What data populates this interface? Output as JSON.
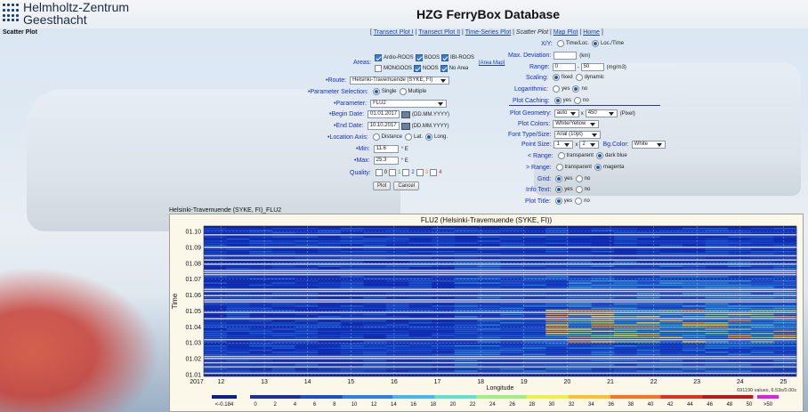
{
  "header": {
    "logo_line1": "Helmholtz-Zentrum",
    "logo_line2": "Geesthacht",
    "title": "HZG FerryBox Database",
    "section": "Scatter Plot"
  },
  "nav": {
    "open": "[",
    "items": [
      {
        "label": "Transect Plot I",
        "current": false
      },
      {
        "label": "Transect Plot II",
        "current": false
      },
      {
        "label": "Time-Series Plot",
        "current": false
      },
      {
        "label": "Scatter Plot",
        "current": true
      },
      {
        "label": "Map Plot",
        "current": false
      },
      {
        "label": "Home",
        "current": false
      }
    ],
    "sep": "|",
    "close": "]"
  },
  "form": {
    "areas_label": "Areas:",
    "areas": [
      {
        "label": "Ardio-ROOS",
        "checked": true
      },
      {
        "label": "BOOS",
        "checked": true
      },
      {
        "label": "IBI-ROOS",
        "checked": true
      },
      {
        "label": "MONGOOS",
        "checked": false
      },
      {
        "label": "NOOS",
        "checked": true
      },
      {
        "label": "No Area",
        "checked": true
      }
    ],
    "area_map_link": "[Area Map]",
    "route_label": "Route:",
    "route_value": "Helsinki-Travemuende (SYKE, FI)",
    "param_sel_label": "Parameter Selection:",
    "param_sel_single": "Single",
    "param_sel_multiple": "Multiple",
    "parameter_label": "Parameter:",
    "parameter_value": "FLU2",
    "begin_label": "Begin Date:",
    "begin_value": "01.01.2017",
    "end_label": "End Date:",
    "end_value": "10.10.2017",
    "date_hint": "(DD.MM.YYYY)",
    "loc_axis_label": "Location Axis:",
    "loc_distance": "Distance",
    "loc_lat": "Lat.",
    "loc_long": "Long.",
    "min_label": "Min:",
    "min_value": "11.6",
    "max_label": "Max:",
    "max_value": "25.3",
    "unit_e": "° E",
    "quality_label": "Quality:",
    "quality_items": [
      "0",
      "1",
      "2",
      "3",
      "4"
    ],
    "plot_button": "Plot",
    "cancel_button": "Cancel"
  },
  "options": {
    "xy_label": "X/Y:",
    "xy_time_loc": "Time/Loc.",
    "xy_loc_time": "Loc./Time",
    "maxdev_label": "Max. Deviation:",
    "maxdev_unit": "(km)",
    "range_label": "Range:",
    "range_min": "0",
    "range_dash": "-",
    "range_max": "50",
    "range_unit": "(mg/m3)",
    "scaling_label": "Scaling:",
    "scaling_fixed": "fixed",
    "scaling_dynamic": "dynamic",
    "log_label": "Logarithmic:",
    "yes": "yes",
    "no": "no",
    "caching_label": "Plot Caching:",
    "geometry_label": "Plot Geometry:",
    "geometry_w": "auto",
    "geometry_x": "x",
    "geometry_h": "450",
    "geometry_unit": "(Pixel)",
    "colors_label": "Plot Colors:",
    "colors_value": "White/Yellow",
    "font_label": "Font Type/Size:",
    "font_value": "Arial (10pt)",
    "point_label": "Point Size:",
    "point_a": "1",
    "point_x": "x",
    "point_b": "2",
    "bg_label": "Bg.Color:",
    "bg_value": "White",
    "lt_range_label": "< Range:",
    "transparent": "transparent",
    "dark_blue": "dark blue",
    "gt_range_label": "> Range:",
    "magenta": "magenta",
    "grid_label": "Grid:",
    "info_label": "Info Text:",
    "title_label": "Plot Title:"
  },
  "chart_caption": "Helsinki-Travemuende (SYKE, FI)_FLU2",
  "chart_data": {
    "type": "heatmap",
    "title": "FLU2 (Helsinki-Travemuende (SYKE, FI))",
    "xlabel": "Longitude",
    "ylabel": "Time",
    "xlim": [
      11.6,
      25.3
    ],
    "x_ticks": [
      12,
      13,
      14,
      15,
      16,
      17,
      18,
      19,
      20,
      21,
      22,
      23,
      24,
      25
    ],
    "y_ticks": [
      "01.01",
      "01.02",
      "01.03",
      "01.04",
      "01.05",
      "01.06",
      "01.07",
      "01.08",
      "01.09",
      "01.10"
    ],
    "year_label": "2017",
    "colorbar": {
      "min_label": "<-0.184",
      "ticks": [
        "0",
        "2",
        "4",
        "6",
        "8",
        "10",
        "12",
        "14",
        "16",
        "18",
        "20",
        "22",
        "24",
        "26",
        "28",
        "30",
        "32",
        "34",
        "36",
        "38",
        "40",
        "42",
        "44",
        "46",
        "48",
        "50",
        ">50"
      ]
    },
    "info_text": "691190 values, 6.53s/0.00s",
    "grid": true,
    "colors": {
      "background": "#0a1f8f",
      "low": "#1436c8",
      "mid": "#2c8cf0",
      "high": "#ffe640",
      "extreme": "#e03020"
    }
  }
}
